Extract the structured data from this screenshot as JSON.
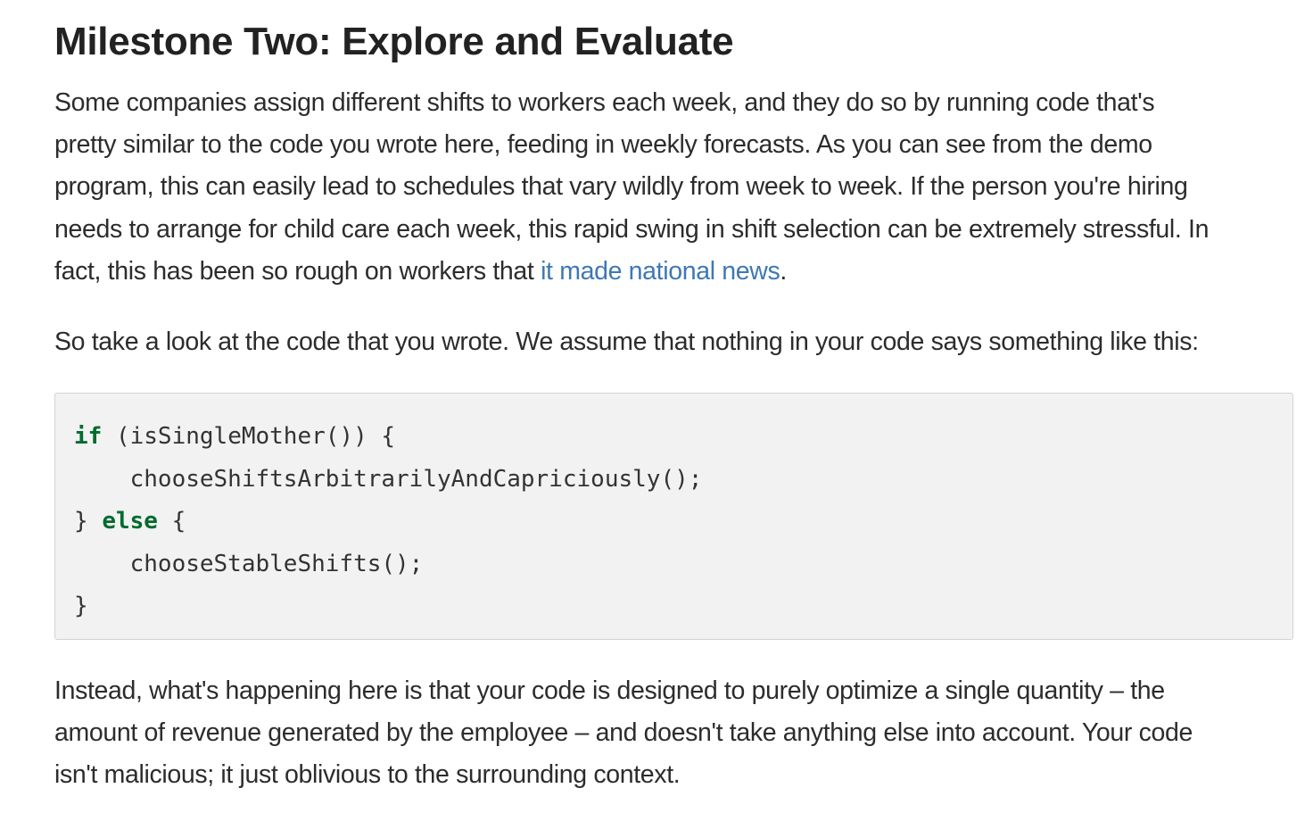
{
  "heading": "Milestone Two: Explore and Evaluate",
  "paragraph1": {
    "lines": [
      "Some companies assign different shifts to workers each week, and they do so by running code that's",
      "pretty similar to the code you wrote here, feeding in weekly forecasts. As you can see from the demo",
      "program, this can easily lead to schedules that vary wildly from week to week. If the person you're hiring",
      "needs to arrange for child care each week, this rapid swing in shift selection can be extremely stressful. In"
    ],
    "last_line_prefix": "fact, this has been so rough on workers that ",
    "link_text": "it made national news",
    "last_line_suffix": "."
  },
  "paragraph2": "So take a look at the code that you wrote. We assume that nothing in your code says something like this:",
  "code": {
    "line1_keyword": "if",
    "line1_rest": " (isSingleMother()) {",
    "line2": "    chooseShiftsArbitrarilyAndCapriciously();",
    "line3_prefix": "} ",
    "line3_keyword": "else",
    "line3_rest": " {",
    "line4": "    chooseStableShifts();",
    "line5": "}"
  },
  "paragraph3": {
    "lines": [
      "Instead, what's happening here is that your code is designed to purely optimize a single quantity – the",
      "amount of revenue generated by the employee – and doesn't take anything else into account. Your code",
      "isn't malicious; it just oblivious to the surrounding context."
    ]
  },
  "colors": {
    "link": "#3f78b3",
    "keyword": "#006b2e",
    "code_background": "#f2f2f2"
  }
}
